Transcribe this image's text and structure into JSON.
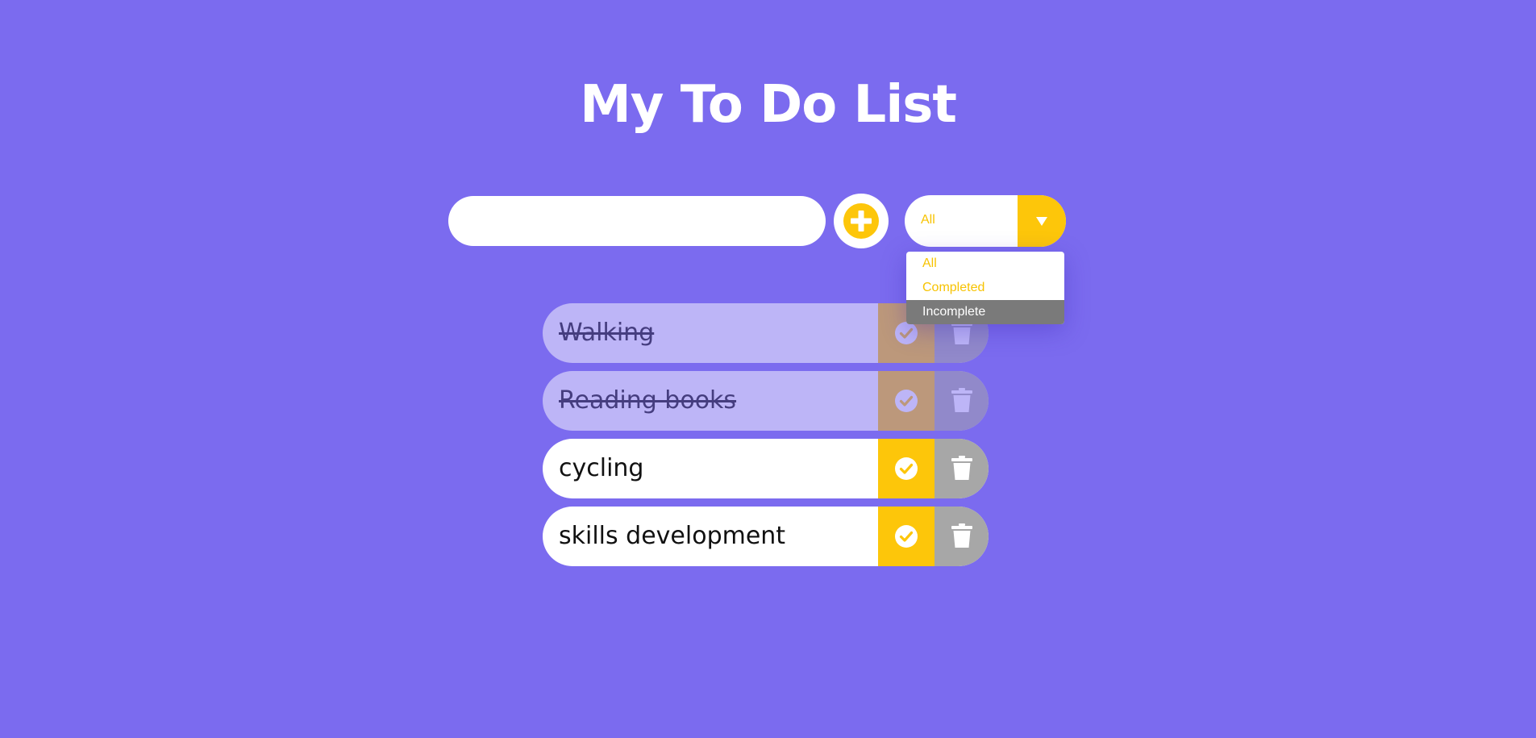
{
  "header": {
    "title": "My To Do List"
  },
  "form": {
    "input_value": "",
    "input_placeholder": "",
    "add_icon": "plus-circle-icon"
  },
  "filter": {
    "selected": "All",
    "options": [
      "All",
      "Completed",
      "Incomplete"
    ],
    "highlighted_option": "Incomplete"
  },
  "todos": [
    {
      "text": "Walking",
      "completed": true
    },
    {
      "text": "Reading books",
      "completed": true
    },
    {
      "text": "cycling",
      "completed": false
    },
    {
      "text": "skills development",
      "completed": false
    }
  ],
  "icons": {
    "complete": "check-circle-icon",
    "delete": "trash-icon",
    "dropdown": "caret-down-icon"
  },
  "colors": {
    "background": "#7b6bef",
    "accent": "#fdc60a",
    "delete": "#a7a7a7",
    "highlight": "#7a7a7a"
  }
}
